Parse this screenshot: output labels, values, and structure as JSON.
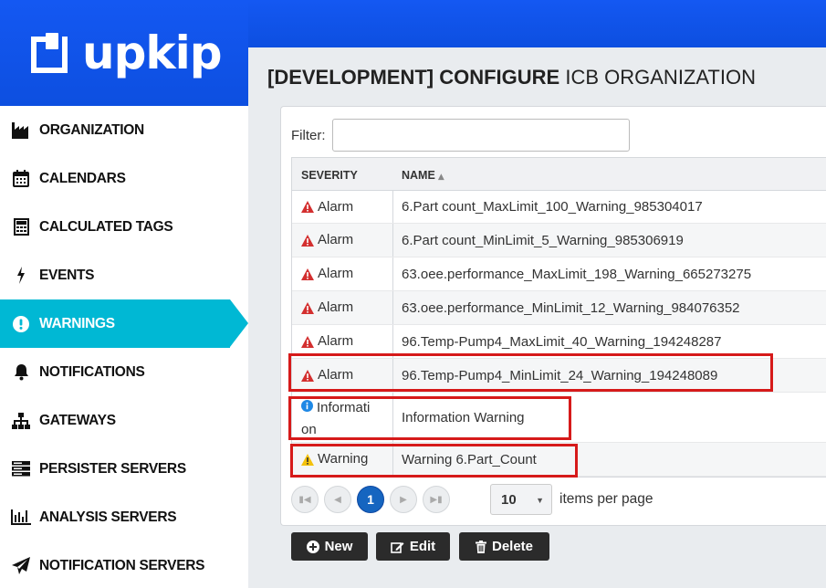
{
  "brand": {
    "logo_text": "upkip"
  },
  "sidebar": {
    "items": [
      {
        "label": "ORGANIZATION",
        "icon": "factory-icon"
      },
      {
        "label": "CALENDARS",
        "icon": "calendar-icon"
      },
      {
        "label": "CALCULATED TAGS",
        "icon": "calculator-icon"
      },
      {
        "label": "EVENTS",
        "icon": "bolt-icon"
      },
      {
        "label": "WARNINGS",
        "icon": "exclamation-circle-icon",
        "active": true
      },
      {
        "label": "NOTIFICATIONS",
        "icon": "bell-icon"
      },
      {
        "label": "GATEWAYS",
        "icon": "sitemap-icon"
      },
      {
        "label": "PERSISTER SERVERS",
        "icon": "server-icon"
      },
      {
        "label": "ANALYSIS SERVERS",
        "icon": "bar-chart-icon"
      },
      {
        "label": "NOTIFICATION SERVERS",
        "icon": "paper-plane-icon"
      }
    ]
  },
  "page": {
    "title_bold": "[DEVELOPMENT] CONFIGURE",
    "title_rest": "ICB ORGANIZATION"
  },
  "filter": {
    "label": "Filter:",
    "value": "",
    "placeholder": ""
  },
  "grid": {
    "headers": {
      "severity": "SEVERITY",
      "name": "NAME"
    },
    "rows": [
      {
        "severity": "Alarm",
        "name": "6.Part count_MaxLimit_100_Warning_985304017"
      },
      {
        "severity": "Alarm",
        "name": "6.Part count_MinLimit_5_Warning_985306919"
      },
      {
        "severity": "Alarm",
        "name": "63.oee.performance_MaxLimit_198_Warning_665273275"
      },
      {
        "severity": "Alarm",
        "name": "63.oee.performance_MinLimit_12_Warning_984076352"
      },
      {
        "severity": "Alarm",
        "name": "96.Temp-Pump4_MaxLimit_40_Warning_194248287"
      },
      {
        "severity": "Alarm",
        "name": "96.Temp-Pump4_MinLimit_24_Warning_194248089"
      },
      {
        "severity_line1": "Informati",
        "severity_line2": "on",
        "name": "Information Warning"
      },
      {
        "severity": "Warning",
        "name": "Warning 6.Part_Count"
      }
    ]
  },
  "pager": {
    "current_page": "1",
    "page_size": "10",
    "items_per_page_label": "items per page"
  },
  "actions": {
    "new_label": "New",
    "edit_label": "Edit",
    "delete_label": "Delete"
  },
  "colors": {
    "brand_blue": "#0d4fe0",
    "active_cyan": "#00b8d4",
    "alarm_red": "#d32f2f",
    "info_blue": "#1e88e5",
    "warning_yellow": "#f4c20d",
    "highlight_red": "#d61a1a"
  }
}
